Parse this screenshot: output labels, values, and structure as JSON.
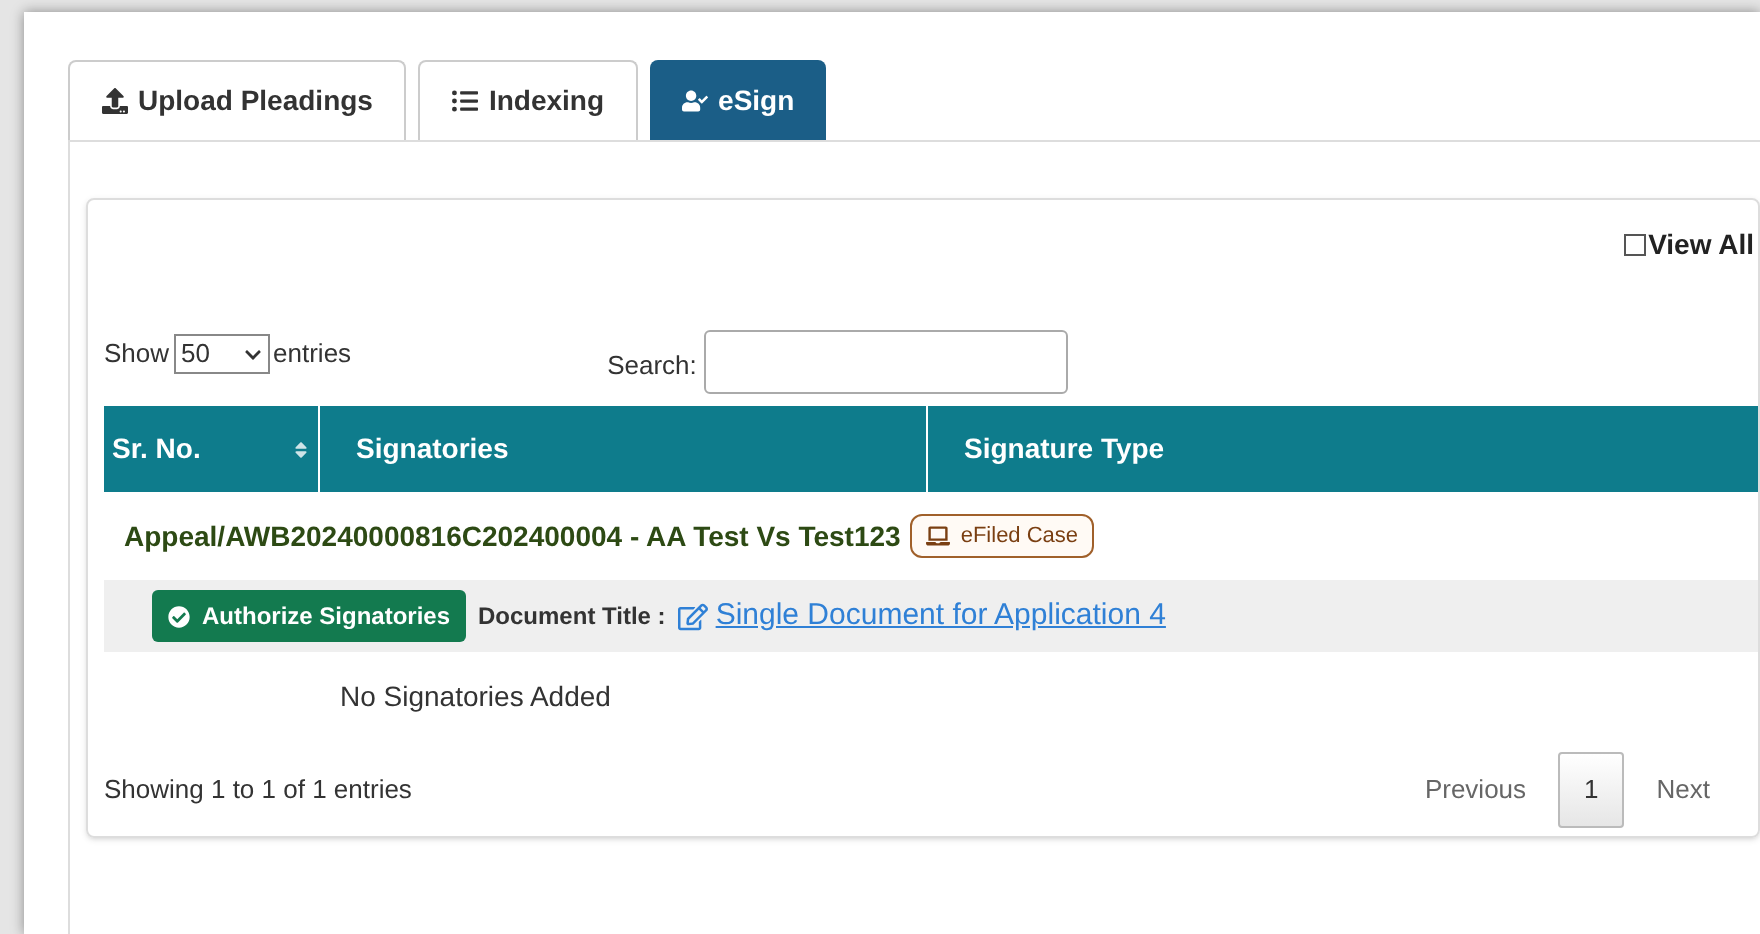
{
  "tabs": [
    {
      "label": "Upload Pleadings",
      "selected": false
    },
    {
      "label": "Indexing",
      "selected": false
    },
    {
      "label": "eSign",
      "selected": true
    }
  ],
  "view_all": {
    "label": "View All",
    "checked": false
  },
  "length": {
    "show": "Show",
    "value": "50",
    "suffix": "entries"
  },
  "search": {
    "label": "Search:"
  },
  "table": {
    "columns": [
      "Sr. No.",
      "Signatories",
      "Signature Type"
    ],
    "group": {
      "case": "Appeal/AWB20240000816C202400004 - AA Test Vs Test123",
      "badge": "eFiled Case"
    },
    "document": {
      "button": "Authorize Signatories",
      "label": "Document Title :",
      "title": "Single Document for Application 4"
    },
    "empty": "No Signatories Added"
  },
  "info": "Showing 1 to 1 of 1 entries",
  "pagination": [
    {
      "label": "Previous",
      "selected": false
    },
    {
      "label": "1",
      "selected": true
    },
    {
      "label": "Next",
      "selected": false
    }
  ]
}
